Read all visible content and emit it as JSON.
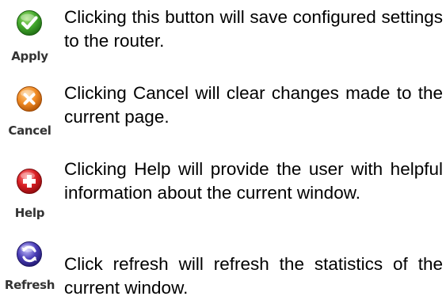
{
  "colors": {
    "apply": "#43a82c",
    "cancel": "#f08a24",
    "help": "#d81e23",
    "refresh": "#4b3eb8"
  },
  "items": [
    {
      "label": "Apply",
      "icon": "checkmark-icon",
      "description": "Clicking this button will save configured settings to the router."
    },
    {
      "label": "Cancel",
      "icon": "x-icon",
      "description": "Clicking Cancel will clear changes made to the current page."
    },
    {
      "label": "Help",
      "icon": "plus-icon",
      "description": "Clicking Help will provide the user with helpful information about the current window."
    },
    {
      "label": "Refresh",
      "icon": "refresh-arrows-icon",
      "description": "Click refresh will refresh the statistics of the current window."
    }
  ]
}
